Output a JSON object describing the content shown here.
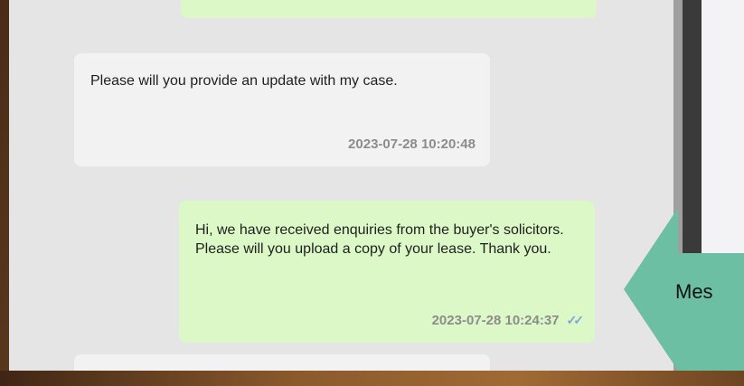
{
  "messages": [
    {
      "direction": "out",
      "text": "",
      "timestamp": ""
    },
    {
      "direction": "in",
      "text": "Please will you provide an update with my case.",
      "timestamp": "2023-07-28 10:20:48"
    },
    {
      "direction": "out",
      "text": "Hi, we have received enquiries from the buyer's solicitors. Please will you upload a copy of your lease. Thank you.",
      "timestamp": "2023-07-28 10:24:37",
      "status": "read"
    },
    {
      "direction": "in",
      "text": "",
      "timestamp": ""
    }
  ],
  "callout": {
    "label": "Mes",
    "color": "#6cbfa3"
  },
  "colors": {
    "outgoing_bubble": "#dcf8c6",
    "incoming_bubble": "#f2f2f2",
    "chat_background": "#e5e5e5",
    "read_ticks": "#7aa7d6"
  },
  "icons": {
    "read_status": "double-check-icon"
  }
}
